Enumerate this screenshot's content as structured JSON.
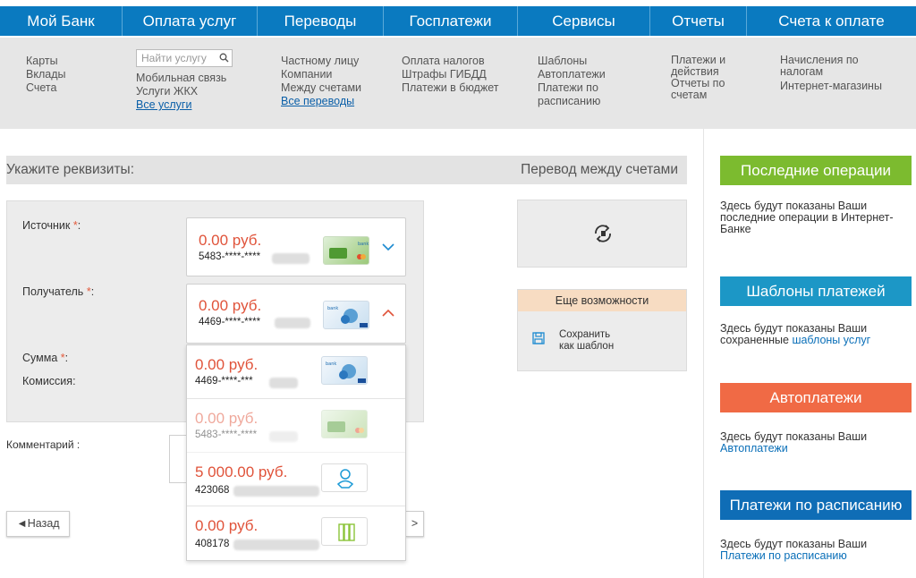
{
  "nav": [
    "Мой Банк",
    "Оплата услуг",
    "Переводы",
    "Госплатежи",
    "Сервисы",
    "Отчеты",
    "Счета к оплате"
  ],
  "submenu": {
    "col1": [
      "Карты",
      "Вклады",
      "Счета"
    ],
    "search_placeholder": "Найти услугу",
    "col2": [
      "Мобильная связь",
      "Услуги ЖКХ"
    ],
    "col2_link": "Все услуги",
    "col3": [
      "Частному лицу",
      "Компании",
      "Между счетами"
    ],
    "col3_link": "Все переводы",
    "col4": [
      "Оплата налогов",
      "Штрафы ГИБДД",
      "Платежи в бюджет"
    ],
    "col5": [
      "Шаблоны",
      "Автоплатежи",
      "Платежи по",
      "расписанию"
    ],
    "col6": [
      "Платежи и",
      "действия",
      "Отчеты по",
      "счетам"
    ],
    "col7": [
      "Начисления по",
      "налогам",
      "Интернет-магазины"
    ]
  },
  "section": {
    "title": "Укажите реквизиты:",
    "transfer_type": "Перевод между счетами"
  },
  "form": {
    "source_label": "Источник",
    "recipient_label": "Получатель",
    "amount_label": "Сумма",
    "fee_label": "Комиссия",
    "required_mark": "*",
    "colon": ":",
    "comment_label": "Комментарий :",
    "source": {
      "amount": "0.00 руб.",
      "number": "5483-****-****"
    },
    "recipient": {
      "amount": "0.00 руб.",
      "number": "4469-****-****"
    }
  },
  "dropdown": [
    {
      "amount": "0.00 руб.",
      "number": "4469-****-***",
      "icon": "card-blue-icon",
      "disabled": false
    },
    {
      "amount": "0.00 руб.",
      "number": "5483-****-****",
      "icon": "card-green-icon",
      "disabled": true
    },
    {
      "amount": "5 000.00 руб.",
      "number": "423068",
      "icon": "piggy-account-icon",
      "disabled": false
    },
    {
      "amount": "0.00 руб.",
      "number": "408178",
      "icon": "binder-account-icon",
      "disabled": false
    }
  ],
  "buttons": {
    "back": "◄Назад",
    "next_arrow": ">"
  },
  "tools": {
    "more_title": "Еще возможности",
    "save_line1": "Сохранить",
    "save_line2": "как шаблон"
  },
  "sidebar": {
    "recent": {
      "title": "Последние операции",
      "text": "Здесь будут показаны Ваши последние операции в Интернет-Банке",
      "color": "#7cbb2f"
    },
    "templates": {
      "title": "Шаблоны платежей",
      "text": "Здесь будут показаны Ваши сохраненные",
      "link": "шаблоны услуг",
      "color": "#1c97c6"
    },
    "auto": {
      "title": "Автоплатежи",
      "text": "Здесь будут показаны Ваши",
      "link": "Автоплатежи",
      "color": "#f06a45"
    },
    "schedule": {
      "title": "Платежи по расписанию",
      "text": "Здесь будут показаны Ваши",
      "link": "Платежи по расписанию",
      "color": "#0f6db6"
    }
  },
  "colors": {
    "nav_bg": "#0a7ac0",
    "amount": "#e0533a",
    "link": "#0a6fb8"
  }
}
